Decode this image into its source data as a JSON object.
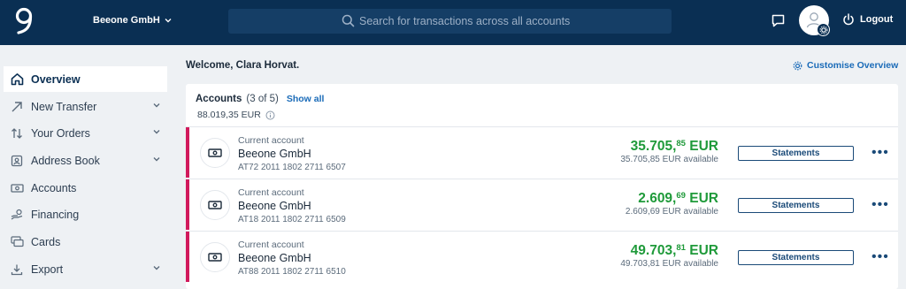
{
  "header": {
    "org_name": "Beeone GmbH",
    "search_placeholder": "Search for transactions across all accounts",
    "logout_label": "Logout"
  },
  "sidebar": {
    "items": [
      {
        "label": "Overview",
        "icon": "home-icon",
        "active": true
      },
      {
        "label": "New Transfer",
        "icon": "arrow-up-right-icon",
        "has_chevron": true
      },
      {
        "label": "Your Orders",
        "icon": "swap-vertical-icon",
        "has_chevron": true
      },
      {
        "label": "Address Book",
        "icon": "contact-card-icon",
        "has_chevron": true
      },
      {
        "label": "Accounts",
        "icon": "banknote-icon"
      },
      {
        "label": "Financing",
        "icon": "hand-coins-icon"
      },
      {
        "label": "Cards",
        "icon": "cards-icon"
      },
      {
        "label": "Export",
        "icon": "download-icon",
        "has_chevron": true
      }
    ]
  },
  "main": {
    "welcome": "Welcome, Clara Horvat.",
    "customise_label": "Customise Overview",
    "accounts": {
      "title": "Accounts",
      "count": "(3 of 5)",
      "show_all": "Show all",
      "total": "88.019,35 EUR",
      "rows": [
        {
          "type": "Current account",
          "name": "Beeone GmbH",
          "iban": "AT72 2011 1802 2711 6507",
          "balance_main": "35.705,",
          "balance_cents": "85",
          "currency": " EUR",
          "available": "35.705,85 EUR available",
          "statements": "Statements"
        },
        {
          "type": "Current account",
          "name": "Beeone GmbH",
          "iban": "AT18 2011 1802 2711 6509",
          "balance_main": "2.609,",
          "balance_cents": "69",
          "currency": " EUR",
          "available": "2.609,69 EUR available",
          "statements": "Statements"
        },
        {
          "type": "Current account",
          "name": "Beeone GmbH",
          "iban": "AT88 2011 1802 2711 6510",
          "balance_main": "49.703,",
          "balance_cents": "81",
          "currency": " EUR",
          "available": "49.703,81 EUR available",
          "statements": "Statements"
        }
      ]
    }
  },
  "colors": {
    "header_bg": "#0a2f53",
    "accent_blue": "#1a6bb8",
    "balance_green": "#1f9a3a",
    "account_stripe": "#d11a5c"
  }
}
